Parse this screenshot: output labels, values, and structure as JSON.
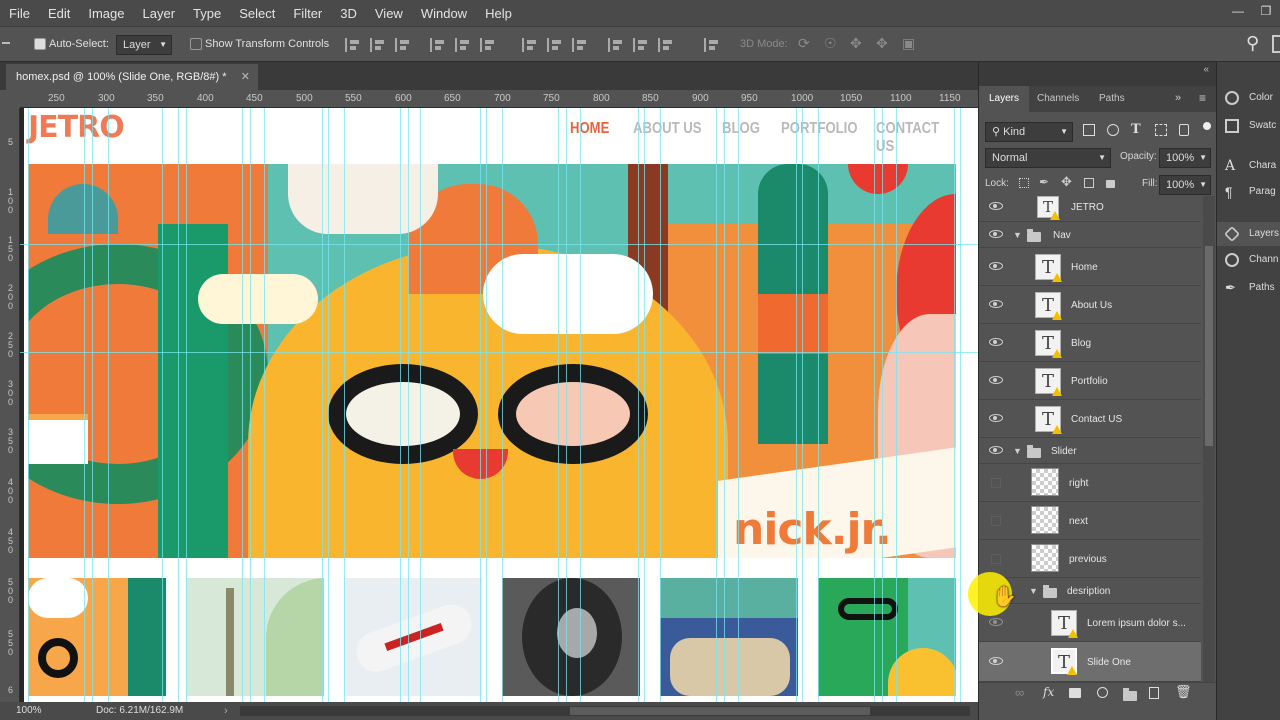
{
  "menu": [
    "File",
    "Edit",
    "Image",
    "Layer",
    "Type",
    "Select",
    "Filter",
    "3D",
    "View",
    "Window",
    "Help"
  ],
  "options": {
    "auto_select_label": "Auto-Select:",
    "auto_select_value": "Layer",
    "transform_label": "Show Transform Controls",
    "mode_3d": "3D Mode:"
  },
  "document": {
    "tab_title": "homex.psd @ 100% (Slide  One, RGB/8#) *",
    "zoom": "100%",
    "doc_size": "Doc: 6.21M/162.9M"
  },
  "rulers": {
    "top": [
      "250",
      "300",
      "350",
      "400",
      "450",
      "500",
      "550",
      "600",
      "650",
      "700",
      "750",
      "800",
      "850",
      "900",
      "950",
      "1000",
      "1050",
      "1100",
      "1150"
    ],
    "left": [
      "5",
      "1 0 0",
      "1 5 0",
      "2 0 0",
      "2 5 0",
      "3 0 0",
      "3 5 0",
      "4 0 0",
      "4 5 0",
      "5 0 0",
      "5 5 0",
      "6"
    ]
  },
  "site": {
    "logo": "JETRO",
    "nav": [
      "HOME",
      "ABOUT US",
      "BLOG",
      "PORTFOLIO",
      "CONTACT US"
    ],
    "hero_brand": "nick.jr."
  },
  "panel": {
    "tabs": [
      "Layers",
      "Channels",
      "Paths"
    ],
    "kind_label": "Kind",
    "blend_mode": "Normal",
    "opacity_label": "Opacity:",
    "opacity_value": "100%",
    "lock_label": "Lock:",
    "fill_label": "Fill:",
    "fill_value": "100%",
    "layers": [
      {
        "name": "JETRO",
        "type": "text",
        "visible": true
      },
      {
        "name": "Nav",
        "type": "group",
        "visible": true
      },
      {
        "name": "Home",
        "type": "text",
        "visible": true
      },
      {
        "name": "About  Us",
        "type": "text",
        "visible": true
      },
      {
        "name": "Blog",
        "type": "text",
        "visible": true
      },
      {
        "name": "Portfolio",
        "type": "text",
        "visible": true
      },
      {
        "name": "Contact  US",
        "type": "text",
        "visible": true
      },
      {
        "name": "Slider",
        "type": "group",
        "visible": true
      },
      {
        "name": "right",
        "type": "image",
        "visible": false
      },
      {
        "name": "next",
        "type": "image",
        "visible": false
      },
      {
        "name": "previous",
        "type": "image",
        "visible": false
      },
      {
        "name": "desription",
        "type": "group",
        "visible": false
      },
      {
        "name": "Lorem ipsum dolor s...",
        "type": "text",
        "visible": true
      },
      {
        "name": "Slide  One",
        "type": "text",
        "visible": true,
        "selected": true
      }
    ]
  },
  "side_strip": [
    "Color",
    "Swatc",
    "Chara",
    "Parag",
    "Layers",
    "Chann",
    "Paths"
  ]
}
